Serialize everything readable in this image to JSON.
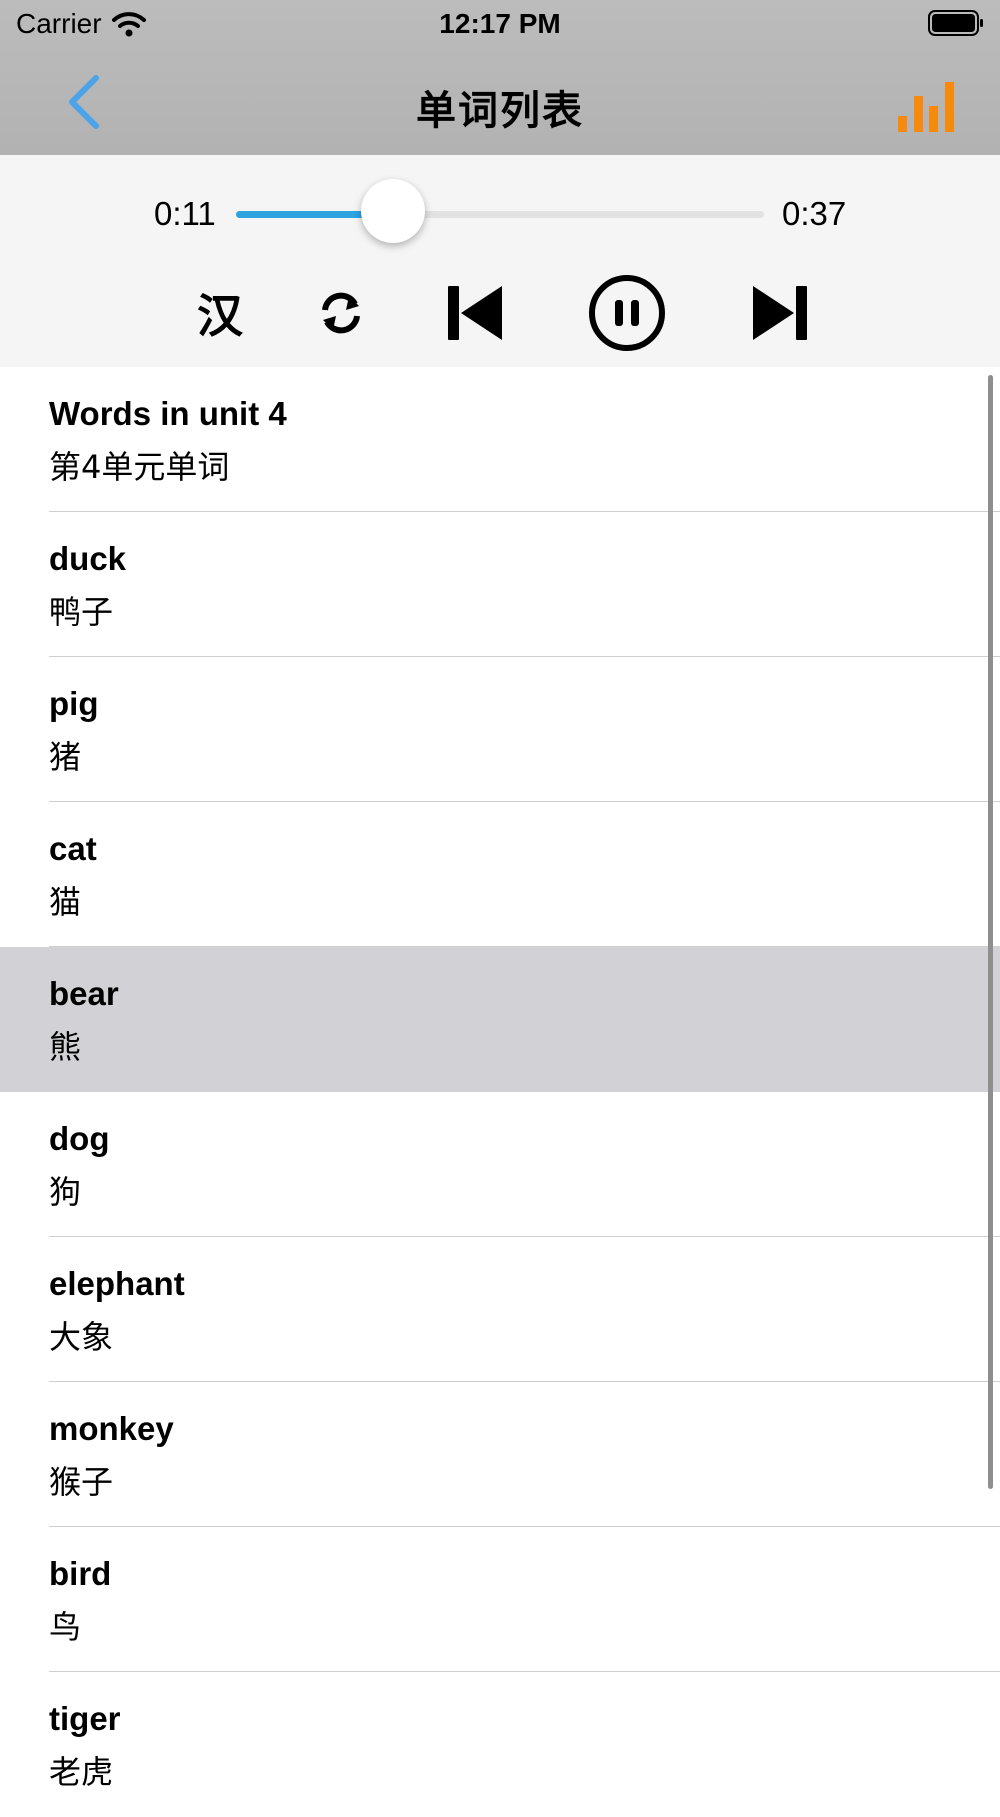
{
  "status": {
    "carrier": "Carrier",
    "time": "12:17 PM"
  },
  "nav": {
    "title": "单词列表",
    "back_icon": "chevron-left-icon",
    "chart_icon": "bar-chart-icon",
    "accent": "#4da3e8",
    "chart_color": "#f7890c"
  },
  "player": {
    "current_time": "0:11",
    "total_time": "0:37",
    "progress": 0.297,
    "translate_label": "汉",
    "buttons": [
      "repeat-icon",
      "previous-icon",
      "pause-icon",
      "next-icon"
    ],
    "progress_color": "#2da3e0"
  },
  "list": {
    "items": [
      {
        "word": "Words in unit 4",
        "meaning": "第4单元单词",
        "selected": false
      },
      {
        "word": "duck",
        "meaning": "鸭子",
        "selected": false
      },
      {
        "word": "pig",
        "meaning": "猪",
        "selected": false
      },
      {
        "word": "cat",
        "meaning": "猫",
        "selected": false
      },
      {
        "word": "bear",
        "meaning": "熊",
        "selected": true
      },
      {
        "word": "dog",
        "meaning": "狗",
        "selected": false
      },
      {
        "word": "elephant",
        "meaning": "大象",
        "selected": false
      },
      {
        "word": "monkey",
        "meaning": "猴子",
        "selected": false
      },
      {
        "word": "bird",
        "meaning": "鸟",
        "selected": false
      },
      {
        "word": "tiger",
        "meaning": "老虎",
        "selected": false
      }
    ]
  }
}
